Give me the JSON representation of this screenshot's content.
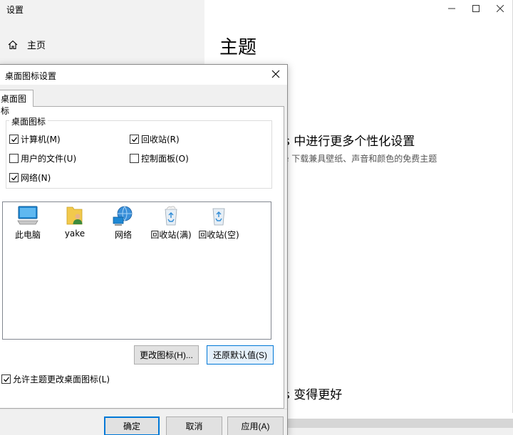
{
  "settings": {
    "window_title": "设置",
    "home_label": "主页",
    "main_heading": "主题",
    "more_heading": "s 中进行更多个性化设置",
    "more_sub": "e 下载兼具壁纸、声音和颜色的免费主题",
    "better_heading": "s 变得更好"
  },
  "dialog": {
    "title": "桌面图标设置",
    "tab_label": "桌面图标",
    "group_label": "桌面图标",
    "checkboxes": [
      {
        "label": "计算机(M)",
        "checked": true
      },
      {
        "label": "回收站(R)",
        "checked": true
      },
      {
        "label": "用户的文件(U)",
        "checked": false
      },
      {
        "label": "控制面板(O)",
        "checked": false
      },
      {
        "label": "网络(N)",
        "checked": true
      }
    ],
    "icons": [
      {
        "label": "此电脑",
        "icon": "computer-icon"
      },
      {
        "label": "yake",
        "icon": "user-folder-icon"
      },
      {
        "label": "网络",
        "icon": "network-icon"
      },
      {
        "label": "回收站(满)",
        "icon": "recycle-bin-full-icon"
      },
      {
        "label": "回收站(空)",
        "icon": "recycle-bin-empty-icon"
      }
    ],
    "change_icon_label": "更改图标(H)...",
    "restore_default_label": "还原默认值(S)",
    "allow_themes_label": "允许主题更改桌面图标(L)",
    "allow_themes_checked": true,
    "ok_label": "确定",
    "cancel_label": "取消",
    "apply_label": "应用(A)"
  },
  "colors": {
    "accent": "#0078d7",
    "sidebar_bg": "#f2f2f2",
    "dialog_bg": "#f0f0f0"
  }
}
